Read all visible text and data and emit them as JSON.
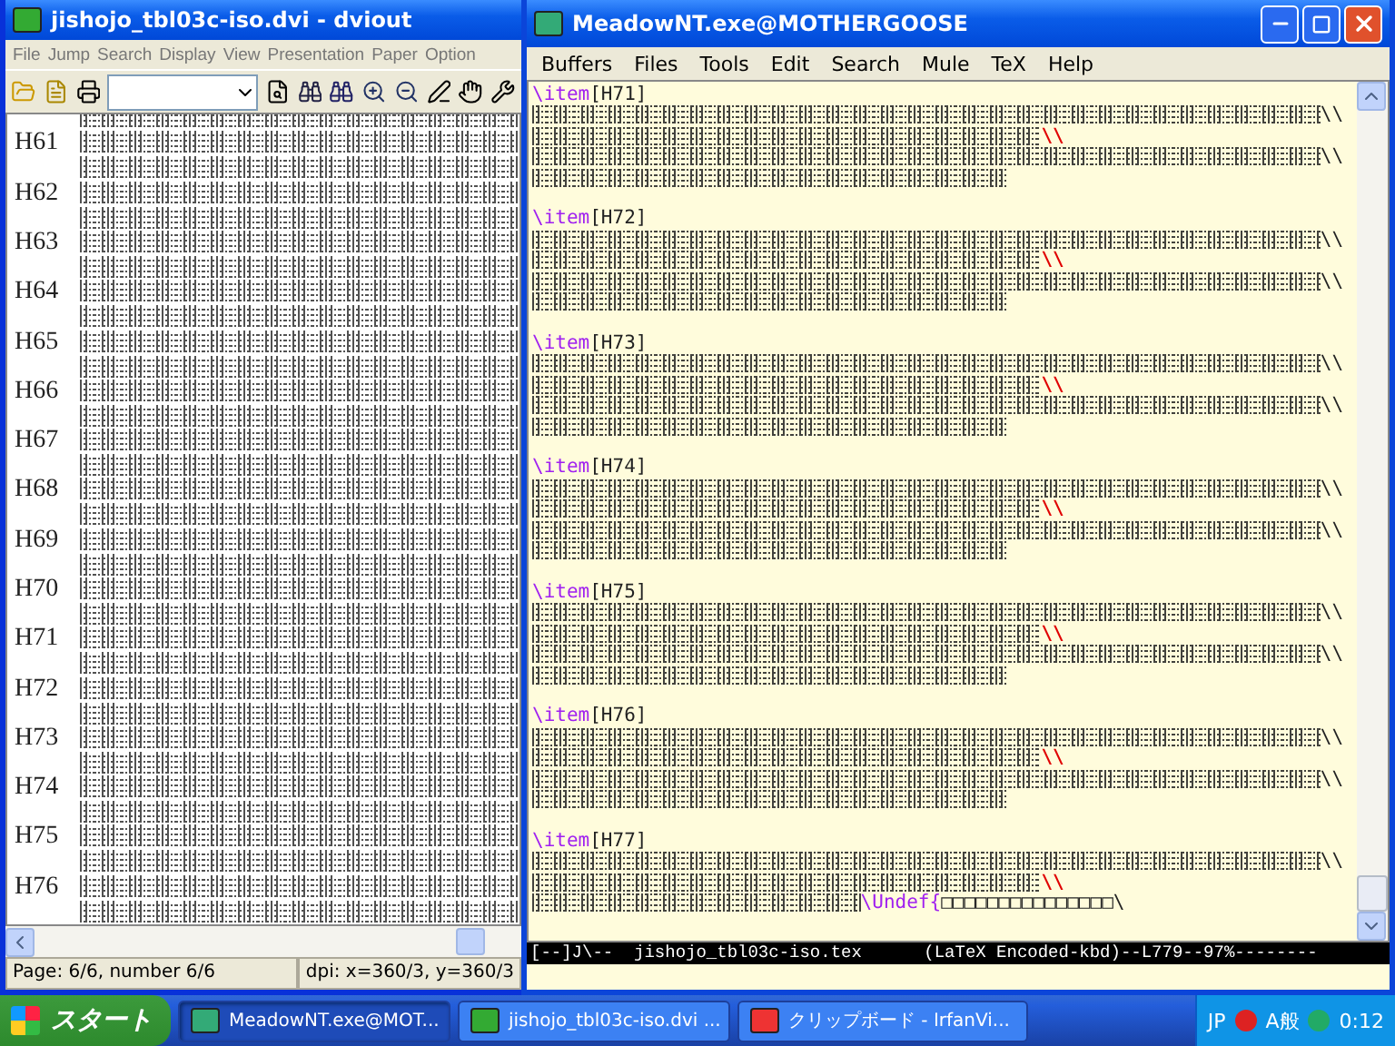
{
  "dviout": {
    "title": "jishojo_tbl03c-iso.dvi - dviout",
    "menu": [
      "File",
      "Jump",
      "Search",
      "Display",
      "View",
      "Presentation",
      "Paper",
      "Option"
    ],
    "rows": [
      {
        "label": "H61"
      },
      {
        "label": "H62"
      },
      {
        "label": "H63"
      },
      {
        "label": "H64"
      },
      {
        "label": "H65"
      },
      {
        "label": "H66"
      },
      {
        "label": "H67"
      },
      {
        "label": "H68"
      },
      {
        "label": "H69"
      },
      {
        "label": "H70"
      },
      {
        "label": "H71"
      },
      {
        "label": "H72"
      },
      {
        "label": "H73"
      },
      {
        "label": "H74"
      },
      {
        "label": "H75"
      },
      {
        "label": "H76"
      }
    ],
    "status": [
      "Page: 6/6, number 6/6",
      "dpi: x=360/3, y=360/3"
    ]
  },
  "meadow": {
    "title": "MeadowNT.exe@MOTHERGOOSE",
    "menu": [
      "Buffers",
      "Files",
      "Tools",
      "Edit",
      "Search",
      "Mule",
      "TeX",
      "Help"
    ],
    "items": [
      {
        "command": "\\item",
        "label": "[H71]",
        "lines": [
          {
            "kind": "break",
            "ending": "\\\\",
            "marked": false
          },
          {
            "kind": "break",
            "ending": "\\\\",
            "marked": true
          },
          {
            "kind": "break",
            "ending": "\\\\",
            "marked": false
          },
          {
            "kind": "plain"
          }
        ]
      },
      {
        "command": "\\item",
        "label": "[H72]",
        "lines": [
          {
            "kind": "break",
            "ending": "\\\\",
            "marked": false
          },
          {
            "kind": "break",
            "ending": "\\\\",
            "marked": true
          },
          {
            "kind": "break",
            "ending": "\\\\",
            "marked": false
          },
          {
            "kind": "plain"
          }
        ]
      },
      {
        "command": "\\item",
        "label": "[H73]",
        "lines": [
          {
            "kind": "break",
            "ending": "\\\\",
            "marked": false
          },
          {
            "kind": "break",
            "ending": "\\\\",
            "marked": true
          },
          {
            "kind": "break",
            "ending": "\\\\",
            "marked": false
          },
          {
            "kind": "plain"
          }
        ]
      },
      {
        "command": "\\item",
        "label": "[H74]",
        "lines": [
          {
            "kind": "break",
            "ending": "\\\\",
            "marked": false
          },
          {
            "kind": "break",
            "ending": "\\\\",
            "marked": true
          },
          {
            "kind": "break",
            "ending": "\\\\",
            "marked": false
          },
          {
            "kind": "plain"
          }
        ]
      },
      {
        "command": "\\item",
        "label": "[H75]",
        "lines": [
          {
            "kind": "break",
            "ending": "\\\\",
            "marked": false
          },
          {
            "kind": "break",
            "ending": "\\\\",
            "marked": true
          },
          {
            "kind": "break",
            "ending": "\\\\",
            "marked": false
          },
          {
            "kind": "plain"
          }
        ]
      },
      {
        "command": "\\item",
        "label": "[H76]",
        "lines": [
          {
            "kind": "break",
            "ending": "\\\\",
            "marked": false
          },
          {
            "kind": "break",
            "ending": "\\\\",
            "marked": true
          },
          {
            "kind": "break",
            "ending": "\\\\",
            "marked": false
          },
          {
            "kind": "plain"
          }
        ]
      },
      {
        "command": "\\item",
        "label": "[H77]",
        "lines": [
          {
            "kind": "break",
            "ending": "\\\\",
            "marked": false
          },
          {
            "kind": "break",
            "ending": "\\\\",
            "marked": true
          },
          {
            "kind": "undef",
            "command": "\\Undef{",
            "rest": "□□□□□□□□□□□□□□□\\"
          }
        ]
      }
    ],
    "mode_line": "[--]J\\--  jishojo_tbl03c-iso.tex      (LaTeX Encoded-kbd)--L779--97%--------"
  },
  "taskbar": {
    "start": "スタート",
    "tasks": [
      {
        "label": "MeadowNT.exe@MOT...",
        "selected": true
      },
      {
        "label": "jishojo_tbl03c-iso.dvi ...",
        "selected": false
      },
      {
        "label": "クリップボード - IrfanVi...",
        "selected": false
      }
    ],
    "tray": {
      "language": "JP",
      "ime": "A般",
      "clock": "0:12"
    }
  }
}
